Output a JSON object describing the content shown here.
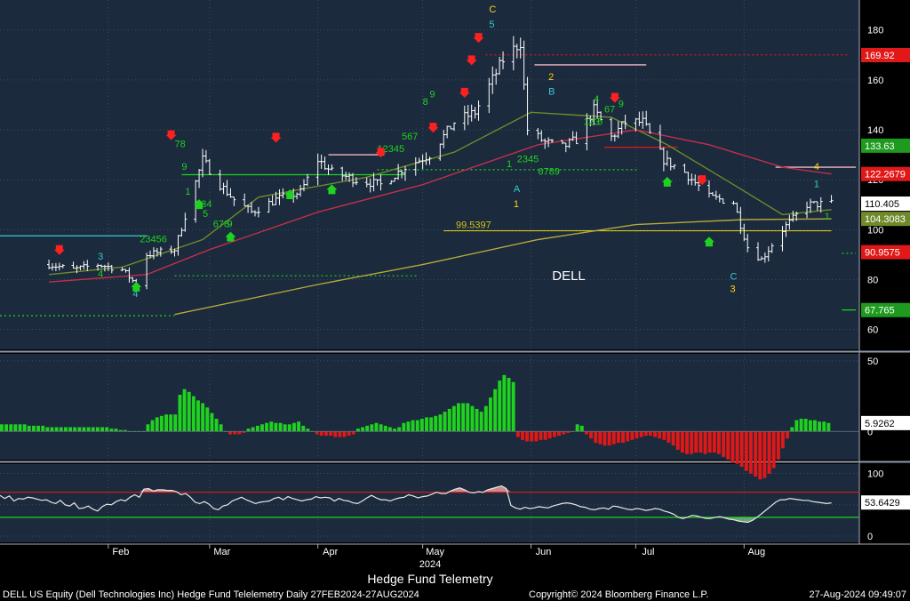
{
  "colors": {
    "panel_bg": "#1b2a3d",
    "axis_bg": "#000000",
    "grid": "#3c4a5c",
    "bar": "#ffffff",
    "sma_fast": "#b5a93a",
    "sma_mid": "#6f8a2a",
    "sma_slow": "#c0304a",
    "hist_pos": "#1fd21f",
    "hist_neg": "#e01818",
    "osc_line": "#e8e8e8",
    "osc_fill_hi": "#e8a0a0",
    "osc_fill_lo": "#7fb87f",
    "level_hi": "#e01818",
    "level_lo": "#1fd21f",
    "label_red": "#e01818",
    "label_green": "#1e9a1e",
    "label_olive": "#6f8a2a",
    "label_white": "#ffffff",
    "demark_green": "#1fd21f",
    "demark_cyan": "#33cccc",
    "demark_yellow": "#ffd21a",
    "arrow_red": "#ff2020",
    "arrow_green": "#1fd21f",
    "level_yellow": "#d2c21a",
    "level_pink": "#f2b8c6",
    "level_green_dot": "#1fd21f",
    "level_red_dot": "#e01818"
  },
  "chart_data": {
    "type": "line",
    "title": "DELL",
    "price_panel": {
      "ylim": [
        52,
        192
      ],
      "yticks": [
        60,
        80,
        100,
        120,
        140,
        160,
        180
      ],
      "series_price": {
        "name": "DELL",
        "date_range": [
          "2024-01-15",
          "2024-08-26"
        ],
        "ohlc_shape": "daily bars"
      },
      "price_path": [
        [
          "2024-01-15",
          86
        ],
        [
          "2024-01-22",
          84
        ],
        [
          "2024-01-29",
          86
        ],
        [
          "2024-02-05",
          84
        ],
        [
          "2024-02-09",
          78
        ],
        [
          "2024-02-12",
          90
        ],
        [
          "2024-02-20",
          92
        ],
        [
          "2024-02-28",
          128
        ],
        [
          "2024-03-04",
          118
        ],
        [
          "2024-03-08",
          112
        ],
        [
          "2024-03-13",
          107
        ],
        [
          "2024-03-20",
          112
        ],
        [
          "2024-03-27",
          115
        ],
        [
          "2024-04-01",
          128
        ],
        [
          "2024-04-05",
          123
        ],
        [
          "2024-04-12",
          120
        ],
        [
          "2024-04-19",
          118
        ],
        [
          "2024-04-26",
          125
        ],
        [
          "2024-05-03",
          130
        ],
        [
          "2024-05-10",
          143
        ],
        [
          "2024-05-16",
          147
        ],
        [
          "2024-05-24",
          168
        ],
        [
          "2024-05-29",
          175
        ],
        [
          "2024-05-31",
          140
        ],
        [
          "2024-06-05",
          135
        ],
        [
          "2024-06-10",
          133
        ],
        [
          "2024-06-14",
          136
        ],
        [
          "2024-06-19",
          148
        ],
        [
          "2024-06-24",
          137
        ],
        [
          "2024-06-28",
          143
        ],
        [
          "2024-07-03",
          143
        ],
        [
          "2024-07-09",
          128
        ],
        [
          "2024-07-15",
          123
        ],
        [
          "2024-07-22",
          113
        ],
        [
          "2024-07-29",
          111
        ],
        [
          "2024-08-02",
          93
        ],
        [
          "2024-08-06",
          88
        ],
        [
          "2024-08-12",
          100
        ],
        [
          "2024-08-19",
          110
        ],
        [
          "2024-08-26",
          110.4
        ]
      ],
      "moving_averages": [
        {
          "key": "sma_fast",
          "points": [
            [
              "2024-02-20",
              66
            ],
            [
              "2024-04-01",
              78
            ],
            [
              "2024-05-01",
              86
            ],
            [
              "2024-06-03",
              96
            ],
            [
              "2024-07-01",
              102
            ],
            [
              "2024-08-01",
              104
            ],
            [
              "2024-08-26",
              104.3
            ]
          ]
        },
        {
          "key": "sma_mid",
          "points": [
            [
              "2024-01-15",
              82
            ],
            [
              "2024-02-05",
              85
            ],
            [
              "2024-02-28",
              96
            ],
            [
              "2024-03-15",
              113
            ],
            [
              "2024-04-15",
              121
            ],
            [
              "2024-05-10",
              131
            ],
            [
              "2024-06-01",
              147
            ],
            [
              "2024-06-24",
              145
            ],
            [
              "2024-07-10",
              134
            ],
            [
              "2024-07-29",
              118
            ],
            [
              "2024-08-12",
              106
            ],
            [
              "2024-08-26",
              108
            ]
          ]
        },
        {
          "key": "sma_slow",
          "points": [
            [
              "2024-01-15",
              79
            ],
            [
              "2024-02-12",
              82
            ],
            [
              "2024-03-01",
              92
            ],
            [
              "2024-04-01",
              107
            ],
            [
              "2024-05-01",
              118
            ],
            [
              "2024-06-03",
              134
            ],
            [
              "2024-07-01",
              140
            ],
            [
              "2024-07-22",
              134
            ],
            [
              "2024-08-12",
              125
            ],
            [
              "2024-08-26",
              122.3
            ]
          ]
        }
      ],
      "price_labels": [
        {
          "value": 169.92,
          "text": "169.92",
          "color": "label_red"
        },
        {
          "value": 133.63,
          "text": "133.63",
          "color": "label_green"
        },
        {
          "value": 122.2679,
          "text": "122.2679",
          "color": "label_red"
        },
        {
          "value": 110.405,
          "text": "110.405",
          "color": "label_white"
        },
        {
          "value": 104.3083,
          "text": "104.3083",
          "color": "label_olive"
        },
        {
          "value": 90.9575,
          "text": "90.9575",
          "color": "label_red"
        },
        {
          "value": 67.765,
          "text": "67.765",
          "color": "label_green"
        }
      ],
      "annotation_level": {
        "value": 99.5397,
        "text": "99.5397"
      }
    },
    "histogram_panel": {
      "ylim": [
        -20,
        55
      ],
      "yticks": [
        0,
        50
      ],
      "last_label": "5.9262",
      "values": [
        5,
        5,
        5,
        5,
        5,
        5,
        4,
        4,
        4,
        4,
        3,
        3,
        3,
        3,
        3,
        3,
        3,
        3,
        3,
        3,
        3,
        3,
        3,
        3,
        2,
        2,
        1,
        1,
        0,
        0,
        0,
        0,
        5,
        8,
        10,
        11,
        12,
        12,
        12,
        26,
        30,
        28,
        25,
        22,
        20,
        17,
        13,
        9,
        5,
        0,
        -2,
        -2,
        -2,
        -1,
        2,
        3,
        4,
        5,
        6,
        7,
        6,
        6,
        5,
        5,
        6,
        7,
        4,
        2,
        0,
        -2,
        -3,
        -3,
        -3,
        -4,
        -4,
        -4,
        -3,
        -2,
        2,
        3,
        4,
        5,
        6,
        5,
        4,
        3,
        2,
        3,
        6,
        7,
        8,
        8,
        9,
        10,
        10,
        11,
        12,
        14,
        16,
        18,
        20,
        20,
        20,
        18,
        16,
        14,
        18,
        24,
        30,
        36,
        40,
        38,
        35,
        -4,
        -6,
        -7,
        -7,
        -7,
        -6,
        -6,
        -5,
        -4,
        -3,
        -2,
        -1,
        0,
        5,
        4,
        -2,
        -5,
        -8,
        -9,
        -10,
        -10,
        -9,
        -8,
        -8,
        -7,
        -6,
        -5,
        -4,
        -3,
        -3,
        -4,
        -5,
        -6,
        -8,
        -10,
        -13,
        -15,
        -16,
        -16,
        -15,
        -15,
        -16,
        -15,
        -15,
        -16,
        -18,
        -20,
        -22,
        -23,
        -25,
        -28,
        -30,
        -32,
        -34,
        -33,
        -30,
        -26,
        -20,
        -12,
        -5,
        3,
        8,
        9,
        9,
        8,
        8,
        7,
        7,
        6
      ]
    },
    "oscillator_panel": {
      "ylim": [
        -10,
        115
      ],
      "yticks": [
        0,
        50,
        100
      ],
      "upper_level": 70,
      "lower_level": 30,
      "last_label": "53.6429",
      "values": [
        65,
        60,
        64,
        56,
        60,
        59,
        62,
        61,
        59,
        57,
        58,
        54,
        52,
        57,
        50,
        48,
        53,
        44,
        45,
        48,
        43,
        40,
        47,
        51,
        50,
        55,
        58,
        56,
        62,
        66,
        62,
        75,
        76,
        72,
        74,
        74,
        73,
        73,
        71,
        66,
        68,
        62,
        54,
        52,
        55,
        51,
        44,
        42,
        48,
        50,
        56,
        59,
        62,
        58,
        55,
        52,
        54,
        55,
        56,
        60,
        62,
        58,
        63,
        60,
        58,
        56,
        58,
        59,
        63,
        61,
        62,
        61,
        56,
        60,
        57,
        56,
        53,
        52,
        56,
        61,
        65,
        61,
        58,
        58,
        56,
        59,
        61,
        62,
        66,
        64,
        61,
        63,
        64,
        67,
        70,
        68,
        68,
        72,
        75,
        77,
        74,
        70,
        69,
        71,
        70,
        74,
        76,
        78,
        80,
        76,
        49,
        45,
        43,
        46,
        44,
        45,
        47,
        46,
        45,
        48,
        50,
        52,
        53,
        52,
        50,
        47,
        46,
        43,
        42,
        44,
        45,
        43,
        48,
        47,
        45,
        43,
        42,
        44,
        43,
        41,
        42,
        44,
        43,
        40,
        38,
        35,
        30,
        28,
        30,
        33,
        32,
        30,
        28,
        28,
        30,
        31,
        29,
        27,
        26,
        24,
        23,
        22,
        25,
        30,
        36,
        42,
        48,
        54,
        58,
        58,
        60,
        59,
        58,
        57,
        57,
        55,
        54,
        53,
        52,
        53
      ]
    },
    "x_axis": {
      "ticks": [
        "Feb",
        "Mar",
        "Apr",
        "May",
        "Jun",
        "Jul",
        "Aug"
      ],
      "year": "2024"
    },
    "demark_labels": [
      {
        "text": "4",
        "date": "2024-01-29",
        "value": 81,
        "color": "demark_green"
      },
      {
        "text": "3",
        "date": "2024-01-29",
        "value": 88,
        "color": "demark_cyan"
      },
      {
        "text": "4",
        "date": "2024-02-08",
        "value": 73,
        "color": "demark_cyan"
      },
      {
        "text": "23456",
        "date": "2024-02-10",
        "value": 95,
        "color": "demark_green"
      },
      {
        "text": "78",
        "date": "2024-02-20",
        "value": 133,
        "color": "demark_green"
      },
      {
        "text": "9",
        "date": "2024-02-22",
        "value": 124,
        "color": "demark_green"
      },
      {
        "text": "1",
        "date": "2024-02-23",
        "value": 114,
        "color": "demark_green"
      },
      {
        "text": "234",
        "date": "2024-02-26",
        "value": 109,
        "color": "demark_green"
      },
      {
        "text": "5",
        "date": "2024-02-28",
        "value": 105,
        "color": "demark_green"
      },
      {
        "text": "678",
        "date": "2024-03-02",
        "value": 101,
        "color": "demark_green"
      },
      {
        "text": "9",
        "date": "2024-03-06",
        "value": 101,
        "color": "demark_green"
      },
      {
        "text": "12345",
        "date": "2024-04-18",
        "value": 131,
        "color": "demark_green"
      },
      {
        "text": "567",
        "date": "2024-04-25",
        "value": 136,
        "color": "demark_green"
      },
      {
        "text": "8",
        "date": "2024-05-01",
        "value": 150,
        "color": "demark_green"
      },
      {
        "text": "9",
        "date": "2024-05-03",
        "value": 153,
        "color": "demark_green"
      },
      {
        "text": "C",
        "date": "2024-05-20",
        "value": 187,
        "color": "demark_yellow"
      },
      {
        "text": "5",
        "date": "2024-05-20",
        "value": 181,
        "color": "demark_cyan"
      },
      {
        "text": "1",
        "date": "2024-05-25",
        "value": 125,
        "color": "demark_green"
      },
      {
        "text": "2345",
        "date": "2024-05-28",
        "value": 127,
        "color": "demark_green"
      },
      {
        "text": "6789",
        "date": "2024-06-03",
        "value": 122,
        "color": "demark_green"
      },
      {
        "text": "A",
        "date": "2024-05-27",
        "value": 115,
        "color": "demark_cyan"
      },
      {
        "text": "1",
        "date": "2024-05-27",
        "value": 109,
        "color": "demark_yellow"
      },
      {
        "text": "2",
        "date": "2024-06-06",
        "value": 160,
        "color": "demark_yellow"
      },
      {
        "text": "B",
        "date": "2024-06-06",
        "value": 154,
        "color": "demark_cyan"
      },
      {
        "text": "4",
        "date": "2024-06-19",
        "value": 151,
        "color": "demark_green"
      },
      {
        "text": "123",
        "date": "2024-06-16",
        "value": 142,
        "color": "demark_green"
      },
      {
        "text": "5",
        "date": "2024-06-20",
        "value": 142,
        "color": "demark_green"
      },
      {
        "text": "67",
        "date": "2024-06-22",
        "value": 147,
        "color": "demark_green"
      },
      {
        "text": "9",
        "date": "2024-06-26",
        "value": 149,
        "color": "demark_green"
      },
      {
        "text": "C",
        "date": "2024-07-28",
        "value": 80,
        "color": "demark_cyan"
      },
      {
        "text": "3",
        "date": "2024-07-28",
        "value": 75,
        "color": "demark_yellow"
      },
      {
        "text": "4",
        "date": "2024-08-21",
        "value": 124,
        "color": "demark_yellow"
      },
      {
        "text": "1",
        "date": "2024-08-21",
        "value": 117,
        "color": "demark_cyan"
      },
      {
        "text": "1",
        "date": "2024-08-24",
        "value": 104,
        "color": "demark_green"
      }
    ],
    "arrows": [
      {
        "dir": "down",
        "date": "2024-01-18",
        "value": 92
      },
      {
        "dir": "down",
        "date": "2024-02-19",
        "value": 138
      },
      {
        "dir": "down",
        "date": "2024-03-20",
        "value": 137
      },
      {
        "dir": "down",
        "date": "2024-04-19",
        "value": 131
      },
      {
        "dir": "down",
        "date": "2024-05-04",
        "value": 141
      },
      {
        "dir": "down",
        "date": "2024-05-13",
        "value": 155
      },
      {
        "dir": "down",
        "date": "2024-05-15",
        "value": 168
      },
      {
        "dir": "down",
        "date": "2024-05-17",
        "value": 177
      },
      {
        "dir": "down",
        "date": "2024-06-25",
        "value": 153
      },
      {
        "dir": "down",
        "date": "2024-07-20",
        "value": 120
      },
      {
        "dir": "up",
        "date": "2024-02-09",
        "value": 77
      },
      {
        "dir": "up",
        "date": "2024-02-27",
        "value": 110
      },
      {
        "dir": "up",
        "date": "2024-03-07",
        "value": 97
      },
      {
        "dir": "up",
        "date": "2024-03-24",
        "value": 114
      },
      {
        "dir": "up",
        "date": "2024-04-05",
        "value": 116
      },
      {
        "dir": "up",
        "date": "2024-07-10",
        "value": 119
      },
      {
        "dir": "up",
        "date": "2024-07-22",
        "value": 95
      }
    ],
    "levels": [
      {
        "kind": "solid",
        "color": "demark_cyan",
        "x0": "2024-01-01",
        "x1": "2024-02-12",
        "value": 97.5
      },
      {
        "kind": "dotted",
        "color": "level_green_dot",
        "x0": "2024-01-01",
        "x1": "2024-02-20",
        "value": 65.5
      },
      {
        "kind": "dotted",
        "color": "level_green_dot",
        "x0": "2024-02-20",
        "x1": "2024-04-30",
        "value": 81.5
      },
      {
        "kind": "solid",
        "color": "level_green_dot",
        "x0": "2024-02-22",
        "x1": "2024-04-26",
        "value": 122
      },
      {
        "kind": "solid",
        "color": "level_pink",
        "x0": "2024-04-04",
        "x1": "2024-04-20",
        "value": 130
      },
      {
        "kind": "dotted",
        "color": "level_green_dot",
        "x0": "2024-04-18",
        "x1": "2024-07-02",
        "value": 124
      },
      {
        "kind": "dotted",
        "color": "level_red_dot",
        "x0": "2024-05-19",
        "x1": "2024-08-31",
        "value": 170
      },
      {
        "kind": "solid",
        "color": "level_pink",
        "x0": "2024-06-02",
        "x1": "2024-07-04",
        "value": 166
      },
      {
        "kind": "solid",
        "color": "level_red_dot",
        "x0": "2024-06-22",
        "x1": "2024-07-13",
        "value": 133
      },
      {
        "kind": "solid",
        "color": "level_pink",
        "x0": "2024-08-10",
        "x1": "2024-09-02",
        "value": 125
      },
      {
        "kind": "solid",
        "color": "level_yellow",
        "x0": "2024-05-07",
        "x1": "2024-08-26",
        "value": 99.5397
      },
      {
        "kind": "dotted",
        "color": "level_green_dot",
        "x0": "2024-08-29",
        "x1": "2024-09-02",
        "value": 90.5
      },
      {
        "kind": "solid",
        "color": "level_green_dot",
        "x0": "2024-08-29",
        "x1": "2024-09-02",
        "value": 67.8
      }
    ]
  },
  "footer": {
    "x_title": "Hedge Fund Telemetry",
    "left": "DELL US Equity (Dell Technologies Inc) Hedge Fund Telelemetry  Daily 27FEB2024-27AUG2024",
    "center": "Copyright© 2024 Bloomberg Finance L.P.",
    "right": "27-Aug-2024 09:49:07"
  }
}
